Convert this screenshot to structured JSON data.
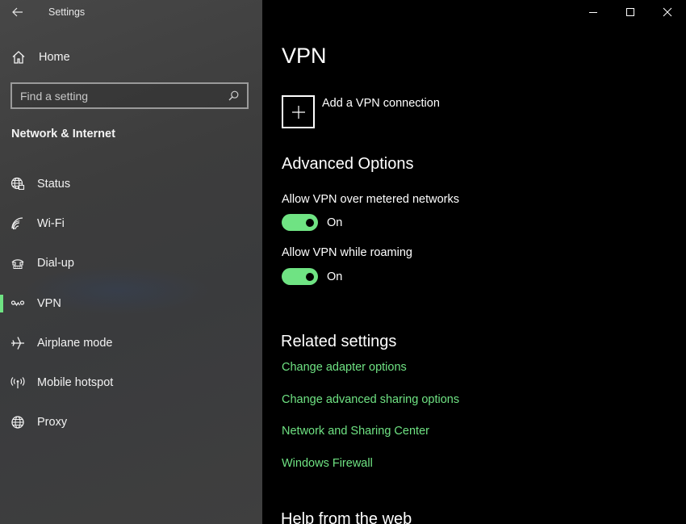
{
  "window": {
    "title": "Settings",
    "controls": {
      "minimize": "minimize-icon",
      "maximize": "maximize-icon",
      "close": "close-icon"
    }
  },
  "sidebar": {
    "home_label": "Home",
    "search": {
      "placeholder": "Find a setting",
      "value": ""
    },
    "section_title": "Network & Internet",
    "items": [
      {
        "label": "Status",
        "icon": "globe-status-icon",
        "active": false
      },
      {
        "label": "Wi-Fi",
        "icon": "wifi-icon",
        "active": false
      },
      {
        "label": "Dial-up",
        "icon": "dialup-icon",
        "active": false
      },
      {
        "label": "VPN",
        "icon": "vpn-icon",
        "active": true
      },
      {
        "label": "Airplane mode",
        "icon": "airplane-icon",
        "active": false
      },
      {
        "label": "Mobile hotspot",
        "icon": "hotspot-icon",
        "active": false
      },
      {
        "label": "Proxy",
        "icon": "globe-icon",
        "active": false
      }
    ]
  },
  "main": {
    "title": "VPN",
    "add_vpn_label": "Add a VPN connection",
    "advanced": {
      "heading": "Advanced Options",
      "options": [
        {
          "label": "Allow VPN over metered networks",
          "state": "On",
          "on": true
        },
        {
          "label": "Allow VPN while roaming",
          "state": "On",
          "on": true
        }
      ]
    },
    "related": {
      "heading": "Related settings",
      "links": [
        "Change adapter options",
        "Change advanced sharing options",
        "Network and Sharing Center",
        "Windows Firewall"
      ]
    },
    "help_heading": "Help from the web"
  },
  "colors": {
    "accent": "#6fe383",
    "sidebar_bg": "#424242",
    "main_bg": "#000000"
  }
}
